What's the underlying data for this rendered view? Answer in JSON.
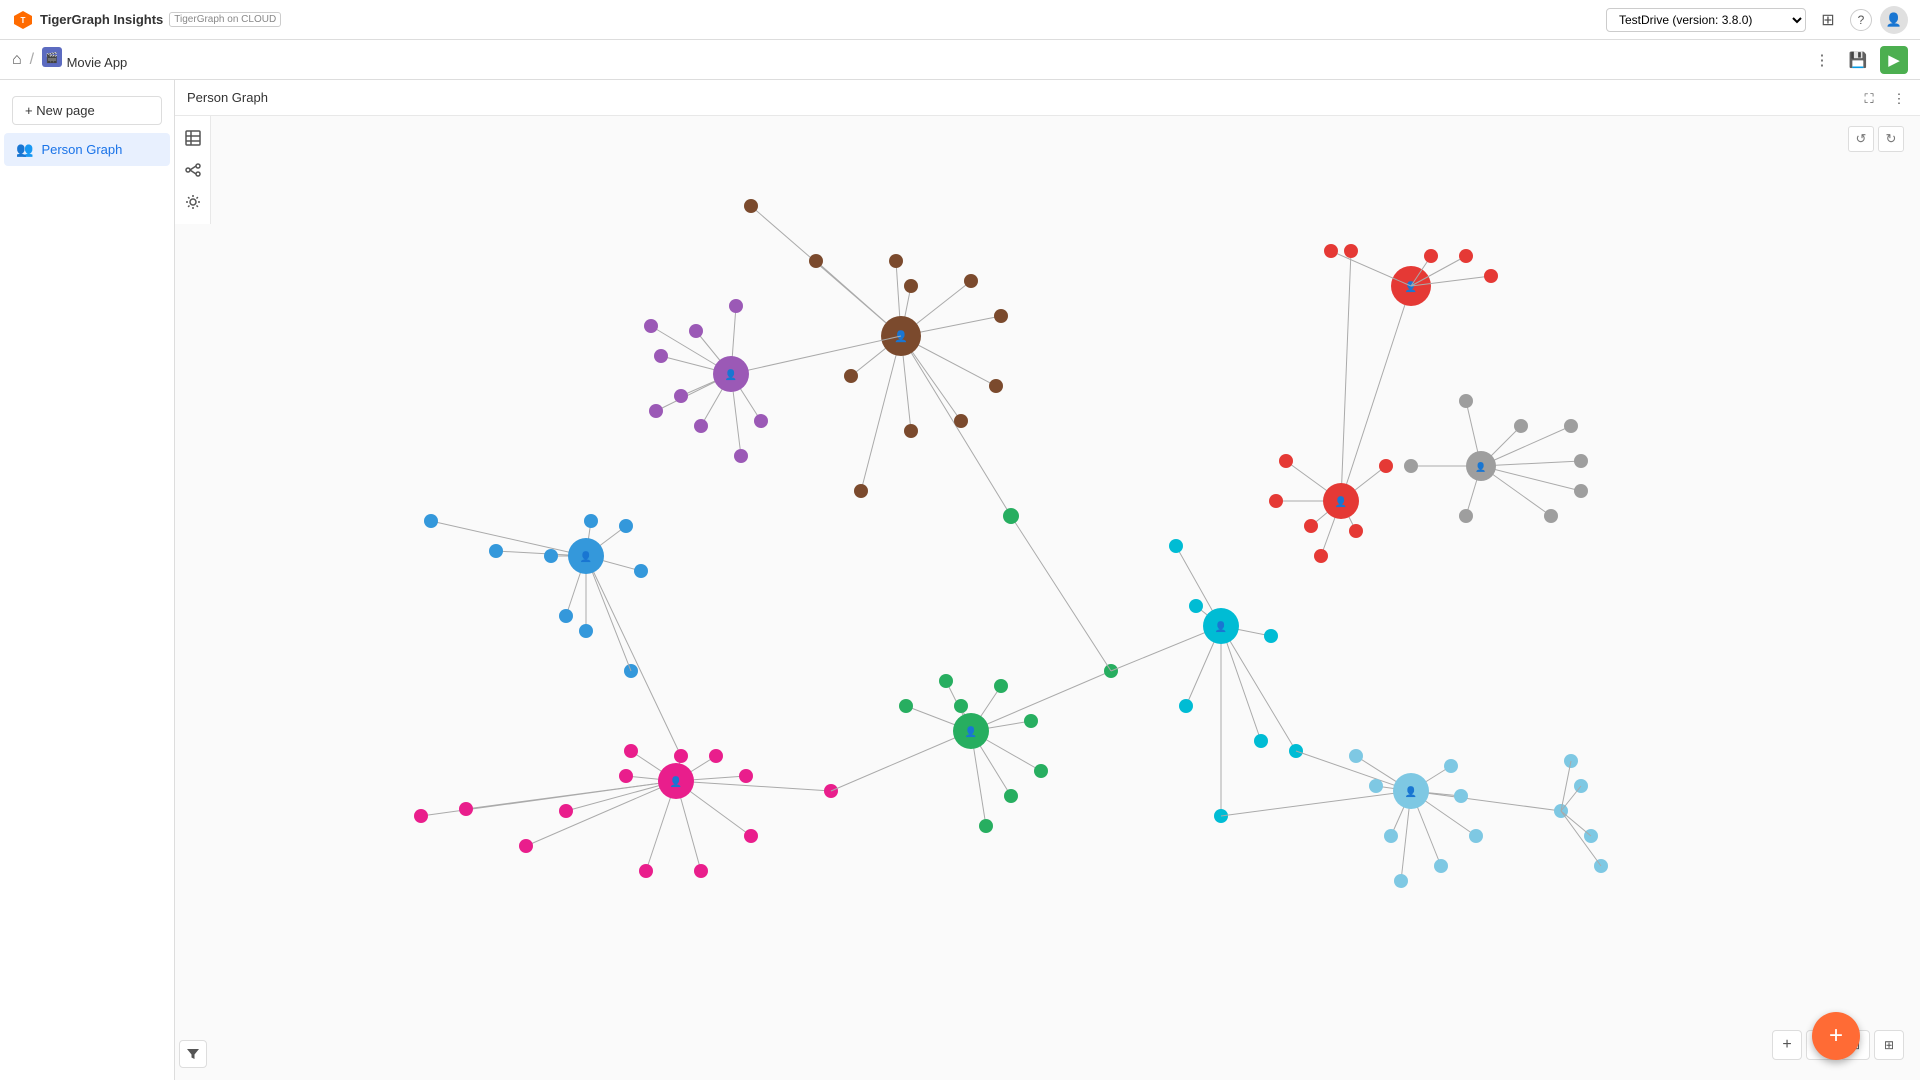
{
  "topbar": {
    "app_name": "TigerGraph Insights",
    "cloud_label": "TigerGraph on CLOUD",
    "version_label": "TestDrive  (version: 3.8.0)",
    "grid_icon": "⊞",
    "help_icon": "?",
    "user_icon": "👤"
  },
  "navbar": {
    "home_icon": "⌂",
    "separator": "/",
    "app_icon_label": "movie-app-icon",
    "app_label": "Movie App",
    "more_icon": "⋮",
    "save_icon": "💾",
    "play_icon": "▶"
  },
  "sidebar": {
    "new_page_label": "+ New page",
    "items": [
      {
        "id": "person-graph",
        "label": "Person Graph",
        "icon": "👥",
        "active": true
      }
    ]
  },
  "graph": {
    "title": "Person Graph",
    "fullscreen_icon": "⛶",
    "more_icon": "⋮",
    "undo_icon": "↺",
    "redo_icon": "↻",
    "toolbar_icons": [
      "⊞",
      "⚙",
      "⚙"
    ],
    "filter_icon": "▼",
    "zoom_plus": "+",
    "zoom_minus": "−",
    "zoom_fit": "⊡",
    "fab_icon": "+"
  },
  "colors": {
    "brown": "#7b4a2d",
    "purple": "#9b59b6",
    "blue": "#3498db",
    "teal": "#1abc9c",
    "cyan": "#00bcd4",
    "green": "#27ae60",
    "pink": "#e91e8c",
    "red": "#e53935",
    "gray": "#9e9e9e",
    "light_blue": "#7ec8e3",
    "orange_fab": "#ff6b35"
  }
}
